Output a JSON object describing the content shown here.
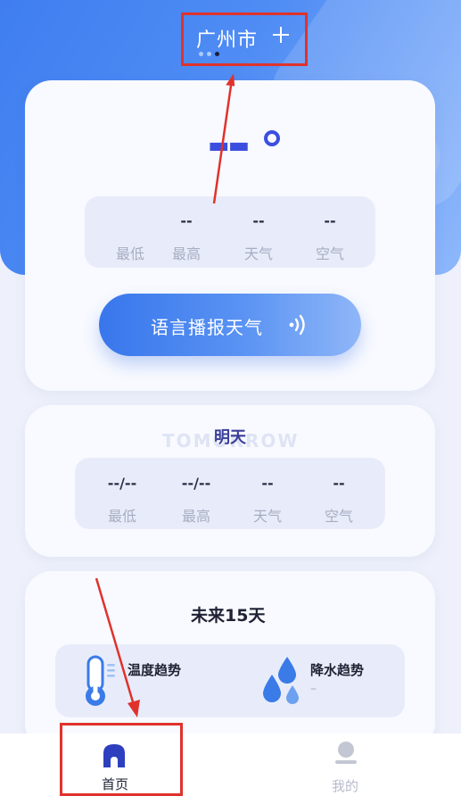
{
  "header": {
    "city": "广州市",
    "add_icon": "plus-icon",
    "page_dots": {
      "count": 3,
      "active_index": 2
    }
  },
  "current": {
    "temperature": "--",
    "stats": [
      {
        "label": "最低",
        "value": ""
      },
      {
        "label": "最高",
        "value": "--"
      },
      {
        "label": "天气",
        "value": "--"
      },
      {
        "label": "空气",
        "value": "--"
      }
    ],
    "voice_button": {
      "label": "语言播报天气",
      "icon": "sound-wave-icon"
    }
  },
  "tomorrow": {
    "title": "明天",
    "watermark": "TOMORROW",
    "stats": [
      {
        "label": "最低",
        "value": "--/--"
      },
      {
        "label": "最高",
        "value": "--/--"
      },
      {
        "label": "天气",
        "value": "--"
      },
      {
        "label": "空气",
        "value": "--"
      }
    ]
  },
  "future": {
    "title": "未来15天",
    "trends": [
      {
        "label": "温度趋势",
        "sub": "",
        "icon": "thermometer-icon"
      },
      {
        "label": "降水趋势",
        "sub": "–",
        "icon": "raindrops-icon"
      }
    ]
  },
  "tabs": [
    {
      "label": "首页",
      "icon": "home-icon",
      "active": true
    },
    {
      "label": "我的",
      "icon": "user-icon",
      "active": false
    }
  ],
  "colors": {
    "accent": "#3a4fe0",
    "header_gradient": "#4f8cf4",
    "annotation_red": "#e0322c",
    "muted": "#a7adc2",
    "active_tab": "#2d3fbf",
    "inactive_tab": "#b6bbcc"
  }
}
